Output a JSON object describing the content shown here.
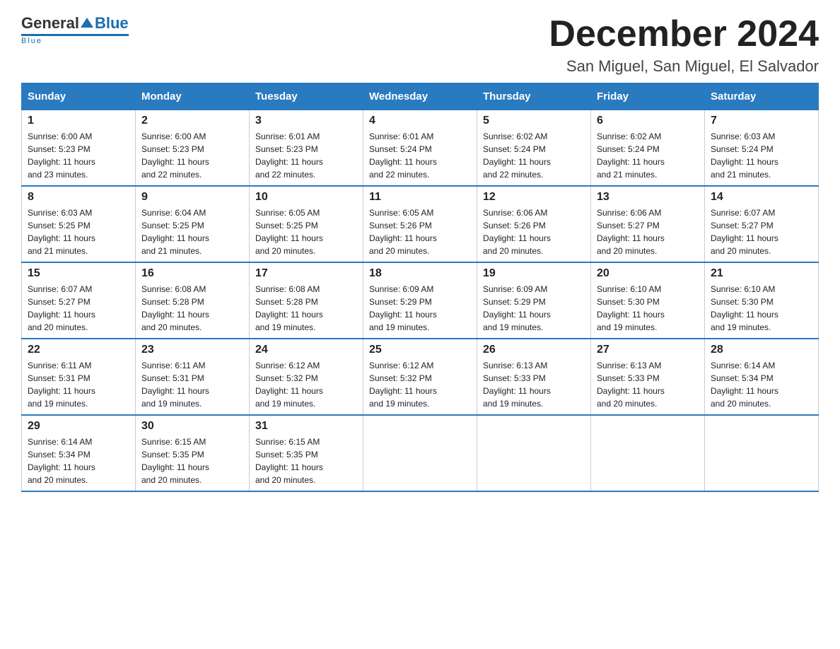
{
  "logo": {
    "general": "General",
    "blue": "Blue",
    "tagline": "Blue"
  },
  "title": "December 2024",
  "subtitle": "San Miguel, San Miguel, El Salvador",
  "days_of_week": [
    "Sunday",
    "Monday",
    "Tuesday",
    "Wednesday",
    "Thursday",
    "Friday",
    "Saturday"
  ],
  "weeks": [
    [
      {
        "num": "1",
        "info": "Sunrise: 6:00 AM\nSunset: 5:23 PM\nDaylight: 11 hours\nand 23 minutes."
      },
      {
        "num": "2",
        "info": "Sunrise: 6:00 AM\nSunset: 5:23 PM\nDaylight: 11 hours\nand 22 minutes."
      },
      {
        "num": "3",
        "info": "Sunrise: 6:01 AM\nSunset: 5:23 PM\nDaylight: 11 hours\nand 22 minutes."
      },
      {
        "num": "4",
        "info": "Sunrise: 6:01 AM\nSunset: 5:24 PM\nDaylight: 11 hours\nand 22 minutes."
      },
      {
        "num": "5",
        "info": "Sunrise: 6:02 AM\nSunset: 5:24 PM\nDaylight: 11 hours\nand 22 minutes."
      },
      {
        "num": "6",
        "info": "Sunrise: 6:02 AM\nSunset: 5:24 PM\nDaylight: 11 hours\nand 21 minutes."
      },
      {
        "num": "7",
        "info": "Sunrise: 6:03 AM\nSunset: 5:24 PM\nDaylight: 11 hours\nand 21 minutes."
      }
    ],
    [
      {
        "num": "8",
        "info": "Sunrise: 6:03 AM\nSunset: 5:25 PM\nDaylight: 11 hours\nand 21 minutes."
      },
      {
        "num": "9",
        "info": "Sunrise: 6:04 AM\nSunset: 5:25 PM\nDaylight: 11 hours\nand 21 minutes."
      },
      {
        "num": "10",
        "info": "Sunrise: 6:05 AM\nSunset: 5:25 PM\nDaylight: 11 hours\nand 20 minutes."
      },
      {
        "num": "11",
        "info": "Sunrise: 6:05 AM\nSunset: 5:26 PM\nDaylight: 11 hours\nand 20 minutes."
      },
      {
        "num": "12",
        "info": "Sunrise: 6:06 AM\nSunset: 5:26 PM\nDaylight: 11 hours\nand 20 minutes."
      },
      {
        "num": "13",
        "info": "Sunrise: 6:06 AM\nSunset: 5:27 PM\nDaylight: 11 hours\nand 20 minutes."
      },
      {
        "num": "14",
        "info": "Sunrise: 6:07 AM\nSunset: 5:27 PM\nDaylight: 11 hours\nand 20 minutes."
      }
    ],
    [
      {
        "num": "15",
        "info": "Sunrise: 6:07 AM\nSunset: 5:27 PM\nDaylight: 11 hours\nand 20 minutes."
      },
      {
        "num": "16",
        "info": "Sunrise: 6:08 AM\nSunset: 5:28 PM\nDaylight: 11 hours\nand 20 minutes."
      },
      {
        "num": "17",
        "info": "Sunrise: 6:08 AM\nSunset: 5:28 PM\nDaylight: 11 hours\nand 19 minutes."
      },
      {
        "num": "18",
        "info": "Sunrise: 6:09 AM\nSunset: 5:29 PM\nDaylight: 11 hours\nand 19 minutes."
      },
      {
        "num": "19",
        "info": "Sunrise: 6:09 AM\nSunset: 5:29 PM\nDaylight: 11 hours\nand 19 minutes."
      },
      {
        "num": "20",
        "info": "Sunrise: 6:10 AM\nSunset: 5:30 PM\nDaylight: 11 hours\nand 19 minutes."
      },
      {
        "num": "21",
        "info": "Sunrise: 6:10 AM\nSunset: 5:30 PM\nDaylight: 11 hours\nand 19 minutes."
      }
    ],
    [
      {
        "num": "22",
        "info": "Sunrise: 6:11 AM\nSunset: 5:31 PM\nDaylight: 11 hours\nand 19 minutes."
      },
      {
        "num": "23",
        "info": "Sunrise: 6:11 AM\nSunset: 5:31 PM\nDaylight: 11 hours\nand 19 minutes."
      },
      {
        "num": "24",
        "info": "Sunrise: 6:12 AM\nSunset: 5:32 PM\nDaylight: 11 hours\nand 19 minutes."
      },
      {
        "num": "25",
        "info": "Sunrise: 6:12 AM\nSunset: 5:32 PM\nDaylight: 11 hours\nand 19 minutes."
      },
      {
        "num": "26",
        "info": "Sunrise: 6:13 AM\nSunset: 5:33 PM\nDaylight: 11 hours\nand 19 minutes."
      },
      {
        "num": "27",
        "info": "Sunrise: 6:13 AM\nSunset: 5:33 PM\nDaylight: 11 hours\nand 20 minutes."
      },
      {
        "num": "28",
        "info": "Sunrise: 6:14 AM\nSunset: 5:34 PM\nDaylight: 11 hours\nand 20 minutes."
      }
    ],
    [
      {
        "num": "29",
        "info": "Sunrise: 6:14 AM\nSunset: 5:34 PM\nDaylight: 11 hours\nand 20 minutes."
      },
      {
        "num": "30",
        "info": "Sunrise: 6:15 AM\nSunset: 5:35 PM\nDaylight: 11 hours\nand 20 minutes."
      },
      {
        "num": "31",
        "info": "Sunrise: 6:15 AM\nSunset: 5:35 PM\nDaylight: 11 hours\nand 20 minutes."
      },
      {
        "num": "",
        "info": ""
      },
      {
        "num": "",
        "info": ""
      },
      {
        "num": "",
        "info": ""
      },
      {
        "num": "",
        "info": ""
      }
    ]
  ]
}
